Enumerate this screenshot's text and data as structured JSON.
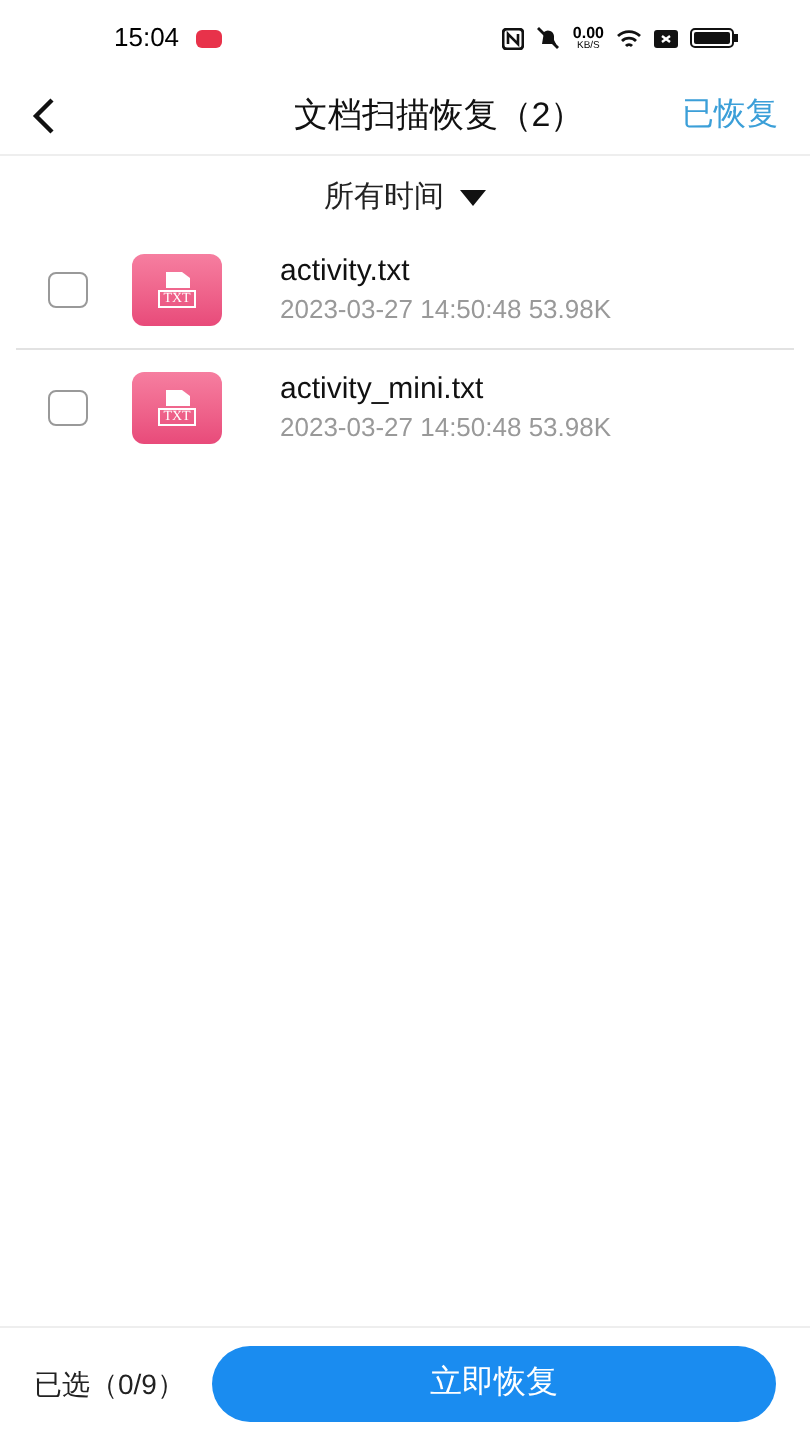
{
  "status_bar": {
    "time": "15:04",
    "speed_value": "0.00",
    "speed_unit": "KB/S"
  },
  "header": {
    "title": "文档扫描恢复（2）",
    "action": "已恢复"
  },
  "filter": {
    "label": "所有时间"
  },
  "files": [
    {
      "name": "activity.txt",
      "meta": "2023-03-27 14:50:48 53.98K",
      "icon_label": "TXT",
      "checked": false
    },
    {
      "name": "activity_mini.txt",
      "meta": "2023-03-27 14:50:48 53.98K",
      "icon_label": "TXT",
      "checked": false
    }
  ],
  "footer": {
    "selected_count": "已选（0/9）",
    "button": "立即恢复"
  }
}
